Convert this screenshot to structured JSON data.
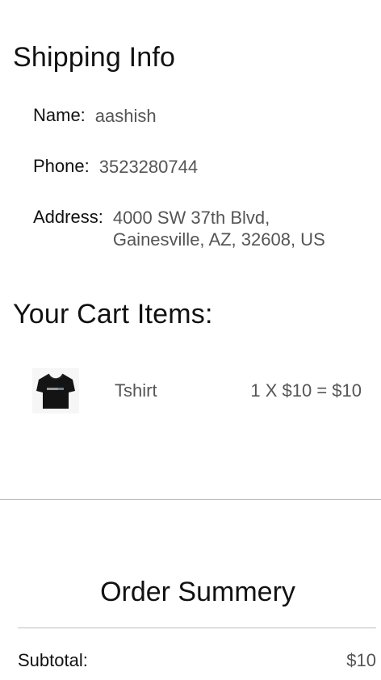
{
  "shipping": {
    "title": "Shipping Info",
    "name_label": "Name:",
    "name_value": "aashish",
    "phone_label": "Phone:",
    "phone_value": "3523280744",
    "address_label": "Address:",
    "address_line1": "4000 SW 37th Blvd,",
    "address_line2": "Gainesville, AZ, 32608, US"
  },
  "cart": {
    "title": "Your Cart Items:",
    "items": [
      {
        "name": "Tshirt",
        "price_text": "1 X $10 = $10",
        "image_icon": "tshirt-image"
      }
    ]
  },
  "summary": {
    "title": "Order Summery",
    "subtotal_label": "Subtotal:",
    "subtotal_value": "$10"
  }
}
